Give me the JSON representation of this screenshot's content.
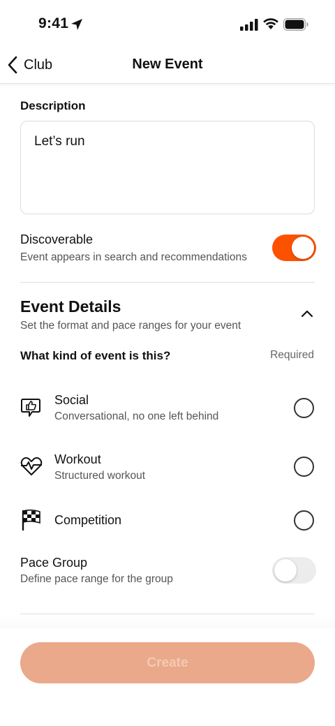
{
  "status_bar": {
    "time": "9:41"
  },
  "nav": {
    "back_label": "Club",
    "title": "New Event"
  },
  "description": {
    "label": "Description",
    "value": "Let’s run"
  },
  "discoverable": {
    "title": "Discoverable",
    "subtitle": "Event appears in search and recommendations",
    "enabled": true
  },
  "event_details": {
    "title": "Event Details",
    "subtitle": "Set the format and pace ranges for your event",
    "question": "What kind of event is this?",
    "required_label": "Required",
    "options": [
      {
        "title": "Social",
        "subtitle": "Conversational, no one left behind",
        "icon": "thumbs-up-bubble-icon",
        "selected": false
      },
      {
        "title": "Workout",
        "subtitle": "Structured workout",
        "icon": "heartbeat-icon",
        "selected": false
      },
      {
        "title": "Competition",
        "subtitle": "",
        "icon": "checkered-flag-icon",
        "selected": false
      }
    ]
  },
  "pace_group": {
    "title": "Pace Group",
    "subtitle": "Define pace range for the group",
    "enabled": false
  },
  "footer": {
    "create_label": "Create"
  },
  "colors": {
    "accent": "#fc5200",
    "button_disabled": "#eaa98a"
  }
}
